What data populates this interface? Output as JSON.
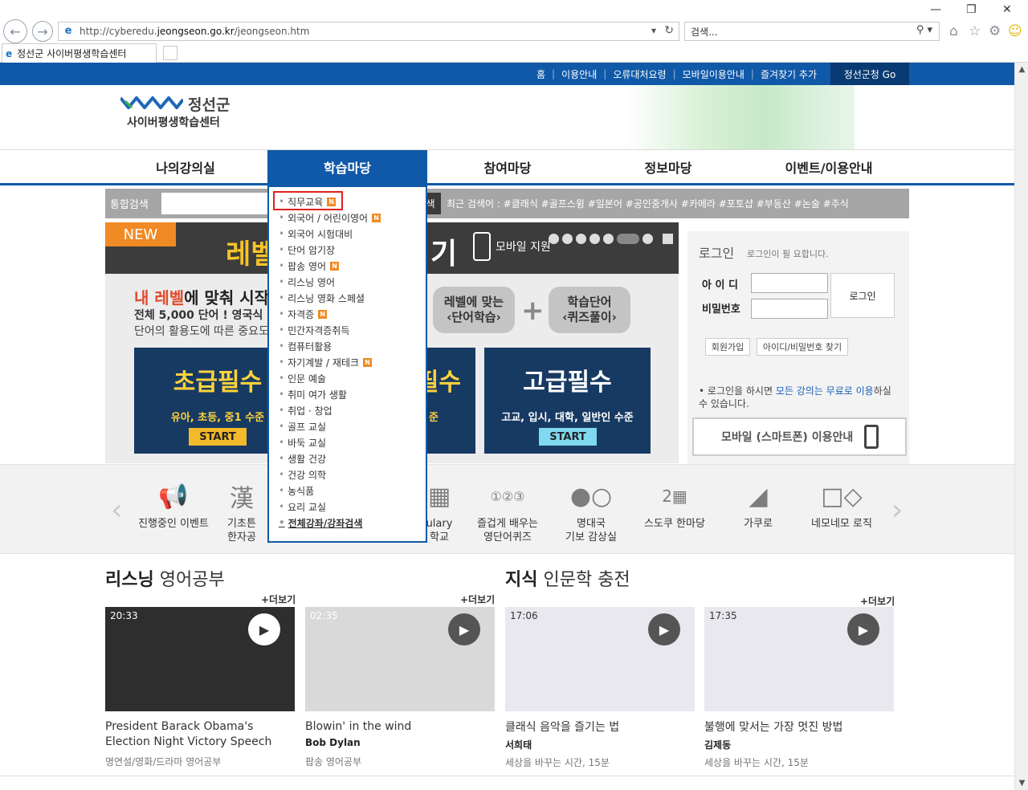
{
  "browser": {
    "url_prefix": "http://cyberedu.",
    "url_host": "jeongseon.go.kr",
    "url_path": "/jeongseon.htm",
    "search_placeholder": "검색...",
    "tab_title": "정선군 사이버평생학습센터"
  },
  "topbar": {
    "links": [
      "홈",
      "이용안내",
      "오류대처요령",
      "모바일이용안내",
      "즐겨찾기 추가"
    ],
    "go_label": "정선군청 Go"
  },
  "logo": {
    "name": "정선군",
    "sub": "사이버평생학습센터"
  },
  "gnb": [
    "나의강의실",
    "학습마당",
    "참여마당",
    "정보마당",
    "이벤트/이용안내"
  ],
  "search": {
    "label": "통합검색",
    "button": "색",
    "recent": "최근 검색어 : #클래식  #골프스윙  #일본어  #공인중개사  #카메라  #포토샵  #부동산  #논술  #주식"
  },
  "slider": {
    "new": "NEW",
    "title_left": "레벨",
    "title_right": "기",
    "mobile": "모바일 지원",
    "sub1_hl": "내 레벨",
    "sub1_rest": "에 맞춰 시작",
    "sub2": "전체 5,000 단어 ! 영국식 & ",
    "sub3": "단어의 활용도에 따른 중요도",
    "pill1": "레벨에 맞는\n‹단어학습›",
    "pill2": "학습단어\n‹퀴즈풀이›",
    "card1": {
      "title": "초급필수",
      "level": "유아, 초등, 중1 수준",
      "start": "START"
    },
    "card2": {
      "title": "필수",
      "level": "준"
    },
    "card3": {
      "title": "고급필수",
      "level": "고교, 입시, 대학, 일반인 수준",
      "start": "START"
    }
  },
  "login": {
    "title": "로그인",
    "subtitle": "로그인이 필 요합니다.",
    "id_label": "아 이 디",
    "pw_label": "비밀번호",
    "login_button": "로그인",
    "join": "회원가입",
    "find": "아이디/비밀번호 찾기",
    "note_a": "로그인을 하시면 ",
    "note_hl": "모든 강의는 무료로 이용",
    "note_b": "하실 수 있습니다.",
    "mobile_info": "모바일 (스마트폰) 이용안내"
  },
  "quick": [
    "진행중인 이벤트",
    "기초튼\n한자공",
    "ulary\n학교",
    "즐겁게 배우는\n영단어퀴즈",
    "명대국\n기보 감상실",
    "스도쿠 한마당",
    "가쿠로",
    "네모네모 로직"
  ],
  "sections": {
    "left_title_b": "리스닝",
    "left_title_rest": " 영어공부",
    "right_title_b": "지식",
    "right_title_rest": " 인문학 충전",
    "more": "+더보기"
  },
  "videos": [
    {
      "time": "20:33",
      "title": "President Barack Obama's Election Night Victory Speech",
      "author": "",
      "category": "명연설/영화/드라마 영어공부"
    },
    {
      "time": "02:35",
      "title": "Blowin' in the wind",
      "author": "Bob Dylan",
      "category": "팝송 영어공부"
    },
    {
      "time": "17:06",
      "title": "클래식 음악을 즐기는 법",
      "author": "서희태",
      "category": "세상을 바꾸는 시간, 15분"
    },
    {
      "time": "17:35",
      "title": "불행에 맞서는 가장 멋진 방법",
      "author": "김제동",
      "category": "세상을 바꾸는 시간, 15분"
    }
  ],
  "dropdown": {
    "items": [
      {
        "label": "직무교육",
        "new": "N"
      },
      {
        "label": "외국어 / 어린이영어",
        "new": "N"
      },
      {
        "label": "외국어 시험대비",
        "new": ""
      },
      {
        "label": "단어 암기장",
        "new": ""
      },
      {
        "label": "팝송 영어",
        "new": "N"
      },
      {
        "label": "리스닝 영어",
        "new": ""
      },
      {
        "label": "리스닝 영화 스페셜",
        "new": ""
      },
      {
        "label": "자격증",
        "new": "N"
      },
      {
        "label": "민간자격증취득",
        "new": ""
      },
      {
        "label": "컴퓨터활용",
        "new": ""
      },
      {
        "label": "자기계발 / 재테크",
        "new": "N"
      },
      {
        "label": "인문 예술",
        "new": ""
      },
      {
        "label": "취미 여가 생활",
        "new": ""
      },
      {
        "label": "취업 · 창업",
        "new": ""
      },
      {
        "label": "골프 교실",
        "new": ""
      },
      {
        "label": "바둑 교실",
        "new": ""
      },
      {
        "label": "생활 건강",
        "new": ""
      },
      {
        "label": "건강 의학",
        "new": ""
      },
      {
        "label": "농식품",
        "new": ""
      },
      {
        "label": "요리 교실",
        "new": ""
      },
      {
        "label": "전체강좌/강좌검색",
        "new": ""
      }
    ]
  },
  "colors": {
    "brand_blue": "#1059a8",
    "highlight_red": "#e2201c",
    "new_orange": "#f08a24"
  }
}
